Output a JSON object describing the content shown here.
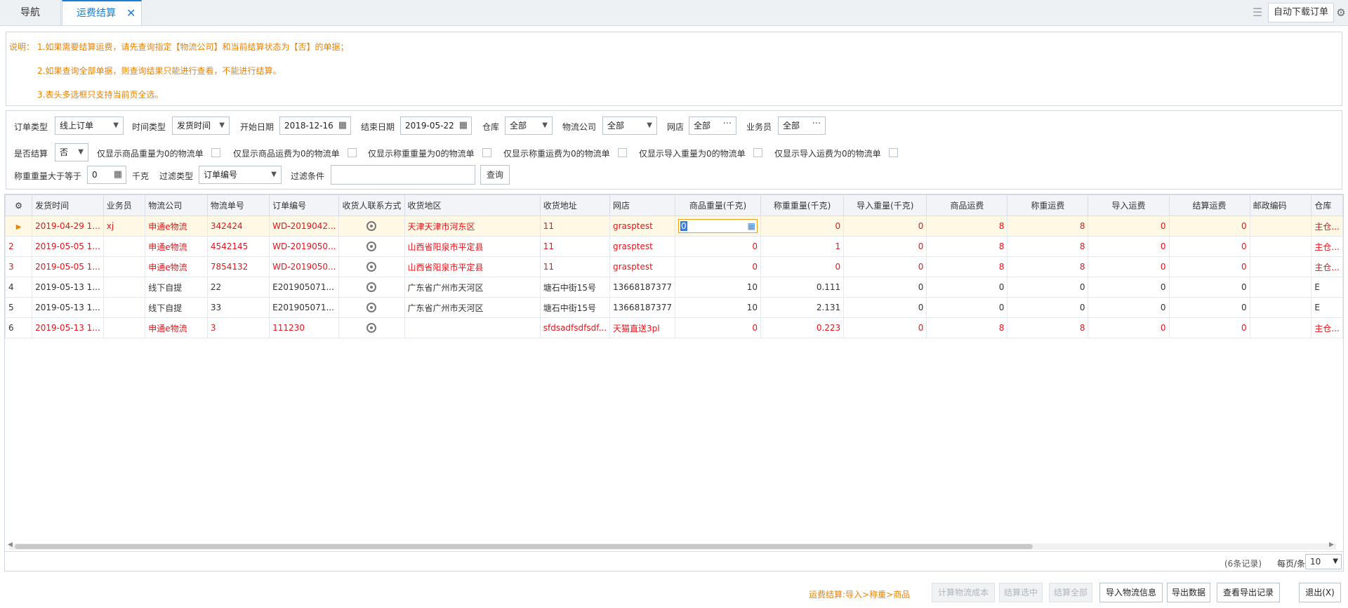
{
  "tabs": {
    "nav_label": "导航",
    "active_label": "运费结算",
    "close_glyph": "✕"
  },
  "toolbar": {
    "list_icon": "list-icon",
    "auto_download_label": "自动下载订单",
    "gear_icon": "gear-icon"
  },
  "notes": {
    "prefix": "说明：",
    "line1": "1.如果需要结算运费，请先查询指定【物流公司】和当前结算状态为【否】的单据；",
    "line2": "2.如果查询全部单据，则查询结果只能进行查看，不能进行结算。",
    "line3": "3.表头多选框只支持当前页全选。"
  },
  "filters": {
    "order_type_label": "订单类型",
    "order_type_value": "线上订单",
    "time_type_label": "时间类型",
    "time_type_value": "发货时间",
    "start_date_label": "开始日期",
    "start_date_value": "2018-12-16",
    "end_date_label": "结束日期",
    "end_date_value": "2019-05-22",
    "warehouse_label": "仓库",
    "warehouse_value": "全部",
    "logistics_label": "物流公司",
    "logistics_value": "全部",
    "shop_label": "网店",
    "shop_value": "全部",
    "salesman_label": "业务员",
    "salesman_value": "全部",
    "settled_label": "是否结算",
    "settled_value": "否",
    "cb1_label": "仅显示商品重量为0的物流单",
    "cb2_label": "仅显示商品运费为0的物流单",
    "cb3_label": "仅显示称重重量为0的物流单",
    "cb4_label": "仅显示称重运费为0的物流单",
    "cb5_label": "仅显示导入重量为0的物流单",
    "cb6_label": "仅显示导入运费为0的物流单",
    "weigh_gte_label": "称重重量大于等于",
    "weigh_gte_value": "0",
    "unit_label": "千克",
    "filter_type_label": "过滤类型",
    "filter_type_value": "订单编号",
    "filter_cond_label": "过滤条件",
    "filter_cond_value": "",
    "query_label": "查询"
  },
  "grid": {
    "columns": [
      "",
      "发货时间",
      "业务员",
      "物流公司",
      "物流单号",
      "订单编号",
      "收货人联系方式",
      "收货地区",
      "收货地址",
      "网店",
      "商品重量(千克)",
      "称重重量(千克)",
      "导入重量(千克)",
      "商品运费",
      "称重运费",
      "导入运费",
      "结算运费",
      "邮政编码",
      "仓库"
    ],
    "rows": [
      {
        "no": "",
        "time": "2019-04-29 1...",
        "staff": "xj",
        "company": "申通e物流",
        "track": "342424",
        "order": "WD-2019042...",
        "region": "天津天津市河东区",
        "addr": "11",
        "shop": "grasptest",
        "gw": "0",
        "ww": "0",
        "iw": "0",
        "gf": "8",
        "wf": "8",
        "if": "0",
        "sf": "0",
        "zip": "",
        "wh": "主仓..."
      },
      {
        "no": "2",
        "time": "2019-05-05 1...",
        "staff": "",
        "company": "申通e物流",
        "track": "4542145",
        "order": "WD-2019050...",
        "region": "山西省阳泉市平定县",
        "addr": "11",
        "shop": "grasptest",
        "gw": "0",
        "ww": "1",
        "iw": "0",
        "gf": "8",
        "wf": "8",
        "if": "0",
        "sf": "0",
        "zip": "",
        "wh": "主仓..."
      },
      {
        "no": "3",
        "time": "2019-05-05 1...",
        "staff": "",
        "company": "申通e物流",
        "track": "7854132",
        "order": "WD-2019050...",
        "region": "山西省阳泉市平定县",
        "addr": "11",
        "shop": "grasptest",
        "gw": "0",
        "ww": "0",
        "iw": "0",
        "gf": "8",
        "wf": "8",
        "if": "0",
        "sf": "0",
        "zip": "",
        "wh": "主仓..."
      },
      {
        "no": "4",
        "time": "2019-05-13 1...",
        "staff": "",
        "company": "线下自提",
        "track": "22",
        "order": "E201905071...",
        "region": "广东省广州市天河区",
        "addr": "塘石中街15号",
        "shop": "13668187377",
        "gw": "10",
        "ww": "0.111",
        "iw": "0",
        "gf": "0",
        "wf": "0",
        "if": "0",
        "sf": "0",
        "zip": "",
        "wh": "E"
      },
      {
        "no": "5",
        "time": "2019-05-13 1...",
        "staff": "",
        "company": "线下自提",
        "track": "33",
        "order": "E201905071...",
        "region": "广东省广州市天河区",
        "addr": "塘石中街15号",
        "shop": "13668187377",
        "gw": "10",
        "ww": "2.131",
        "iw": "0",
        "gf": "0",
        "wf": "0",
        "if": "0",
        "sf": "0",
        "zip": "",
        "wh": "E"
      },
      {
        "no": "6",
        "time": "2019-05-13 1...",
        "staff": "",
        "company": "申通e物流",
        "track": "3",
        "order": "111230",
        "region": "",
        "addr": "sfdsadfsdfsdf...",
        "shop": "天猫直送3pl",
        "gw": "0",
        "ww": "0.223",
        "iw": "0",
        "gf": "8",
        "wf": "8",
        "if": "0",
        "sf": "0",
        "zip": "",
        "wh": "主仓..."
      }
    ],
    "footer_count": "(6条记录)",
    "per_page_label": "每页/条",
    "per_page_value": "10"
  },
  "bottom": {
    "hint": "运费结算:导入>称重>商品",
    "btn_calc_cost": "计算物流成本",
    "btn_settle_selected": "结算选中",
    "btn_settle_all": "结算全部",
    "btn_import_logistics": "导入物流信息",
    "btn_export_data": "导出数据",
    "btn_view_export": "查看导出记录",
    "btn_exit": "退出(X)"
  },
  "colors": {
    "accent": "#1a7fd4",
    "note_orange": "#f08200",
    "row_red": "#e8141b"
  }
}
